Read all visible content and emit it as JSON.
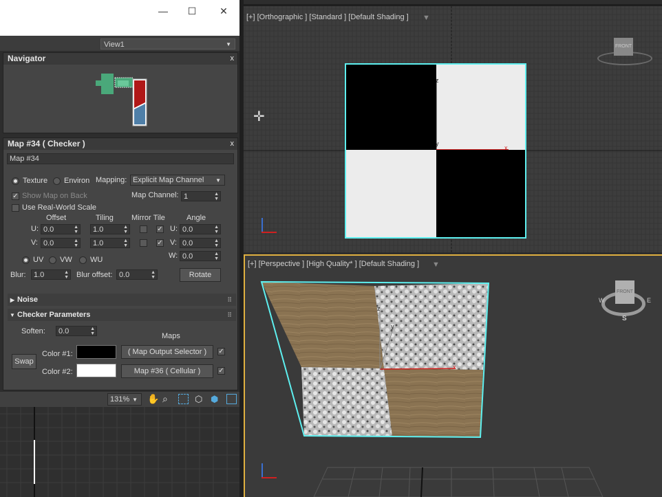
{
  "window": {
    "minimize_glyph": "—",
    "maximize_glyph": "☐",
    "close_glyph": "✕"
  },
  "view_selector": {
    "value": "View1"
  },
  "navigator": {
    "title": "Navigator",
    "close": "x"
  },
  "map_panel": {
    "title": "Map #34  ( Checker )",
    "close": "x",
    "name_field": "Map #34",
    "texture_label": "Texture",
    "environ_label": "Environ",
    "mapping_label": "Mapping:",
    "mapping_value": "Explicit Map Channel",
    "map_channel_label": "Map Channel:",
    "map_channel_value": "1",
    "show_map_on_back": "Show Map on Back",
    "use_real_world_scale": "Use Real-World Scale",
    "col_offset": "Offset",
    "col_tiling": "Tiling",
    "col_mirror_tile": "Mirror Tile",
    "col_angle": "Angle",
    "u_label": "U:",
    "v_label": "V:",
    "w_label": "W:",
    "u_offset": "0.0",
    "v_offset": "0.0",
    "u_tiling": "1.0",
    "v_tiling": "1.0",
    "u_angle": "0.0",
    "v_angle": "0.0",
    "w_angle": "0.0",
    "uv_label": "UV",
    "vw_label": "VW",
    "wu_label": "WU",
    "blur_label": "Blur:",
    "blur_value": "1.0",
    "blur_offset_label": "Blur offset:",
    "blur_offset_value": "0.0",
    "rotate_label": "Rotate",
    "noise_rollout": "Noise",
    "checker_rollout": "Checker Parameters",
    "soften_label": "Soften:",
    "soften_value": "0.0",
    "maps_label": "Maps",
    "swap_label": "Swap",
    "color1_label": "Color #1:",
    "color2_label": "Color #2:",
    "color1": "#000000",
    "color2": "#ffffff",
    "map1_button": "( Map Output Selector )",
    "map2_button": "Map #36  ( Cellular )"
  },
  "bottom_toolbar": {
    "zoom": "131%"
  },
  "viewport_top": {
    "label": "[+] [Orthographic ] [Standard ] [Default Shading ]",
    "cube_label": "FRONT",
    "axis_x": "x",
    "axis_y": "y",
    "axis_z": "z"
  },
  "viewport_persp": {
    "label": "[+] [Perspective ] [High Quality* ] [Default Shading ]",
    "cube_label": "FRONT",
    "compass_w": "W",
    "compass_e": "E",
    "compass_s": "S",
    "axis_x": "x",
    "axis_y": "y",
    "axis_z": "z"
  },
  "colors": {
    "accent_border": "#e0b040",
    "selection": "#5ef0f0",
    "panel": "#454545"
  }
}
